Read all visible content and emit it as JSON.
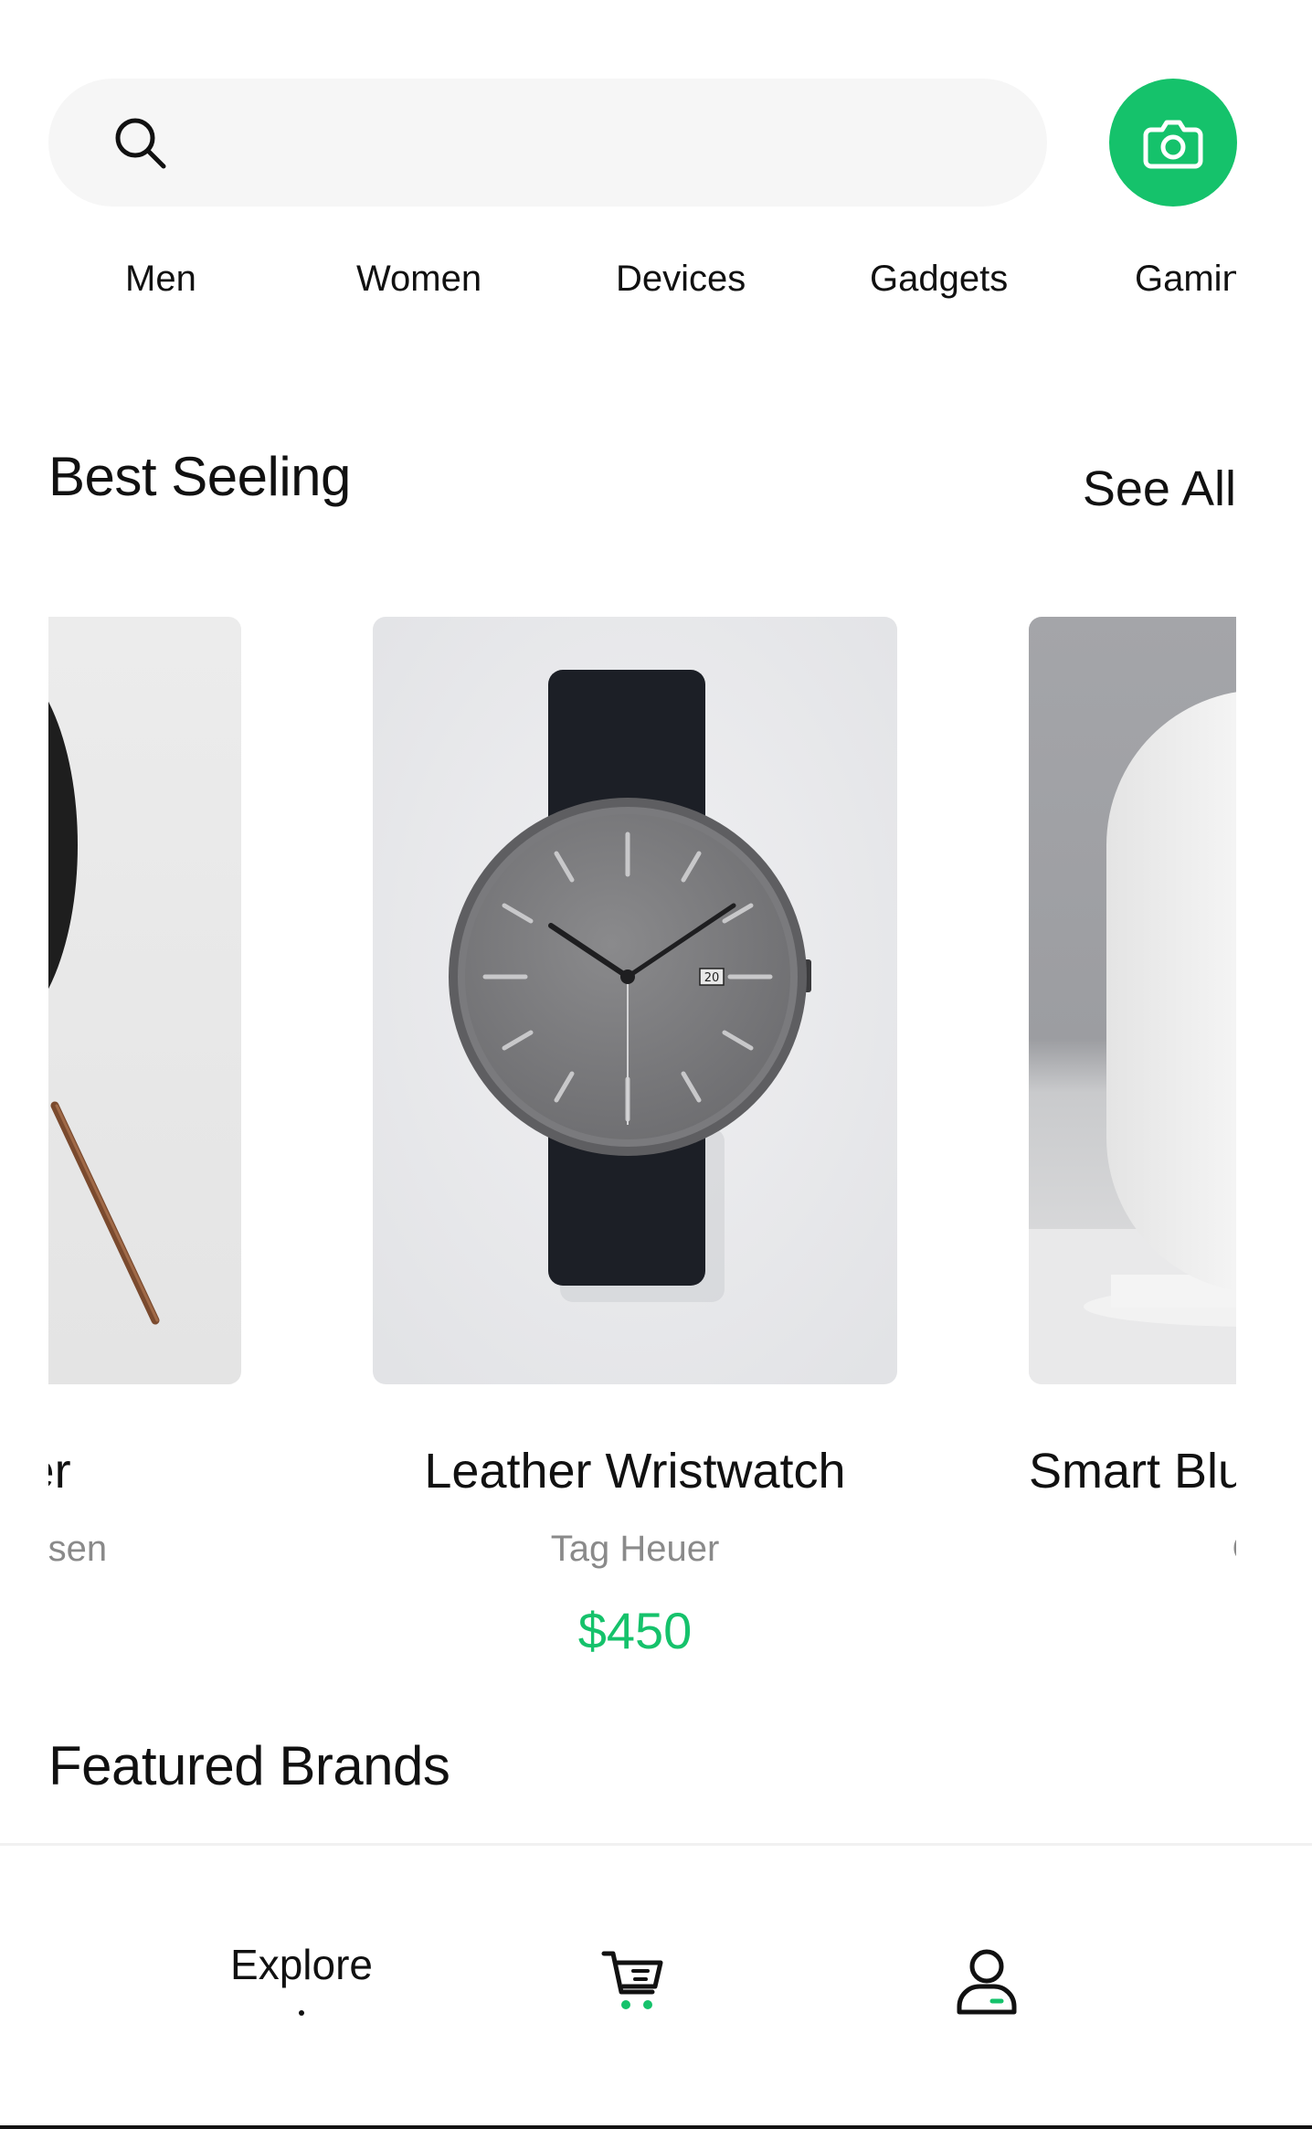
{
  "search": {
    "placeholder": "",
    "value": "",
    "icon": "search-icon",
    "camera_icon": "camera-icon",
    "accent_color": "#15c26b"
  },
  "categories": [
    {
      "label": "Men"
    },
    {
      "label": "Women"
    },
    {
      "label": "Devices"
    },
    {
      "label": "Gadgets"
    },
    {
      "label": "Gaming"
    }
  ],
  "best_selling": {
    "title": "Best Seeling",
    "see_all_label": "See All",
    "products": [
      {
        "name": "Speaker",
        "brand": "Bang & Olufsen",
        "price": ""
      },
      {
        "name": "Leather Wristwatch",
        "brand": "Tag Heuer",
        "price": "$450"
      },
      {
        "name": "Smart Bluetooth Speaker",
        "brand": "Google",
        "price": "$"
      }
    ]
  },
  "featured_brands": {
    "title": "Featured Brands"
  },
  "bottom_nav": {
    "explore_label": "Explore",
    "cart_icon": "cart-icon",
    "profile_icon": "profile-icon"
  },
  "colors": {
    "accent": "#15c26b",
    "text": "#111111",
    "muted": "#8a8a8a",
    "search_bg": "#f6f6f6"
  }
}
